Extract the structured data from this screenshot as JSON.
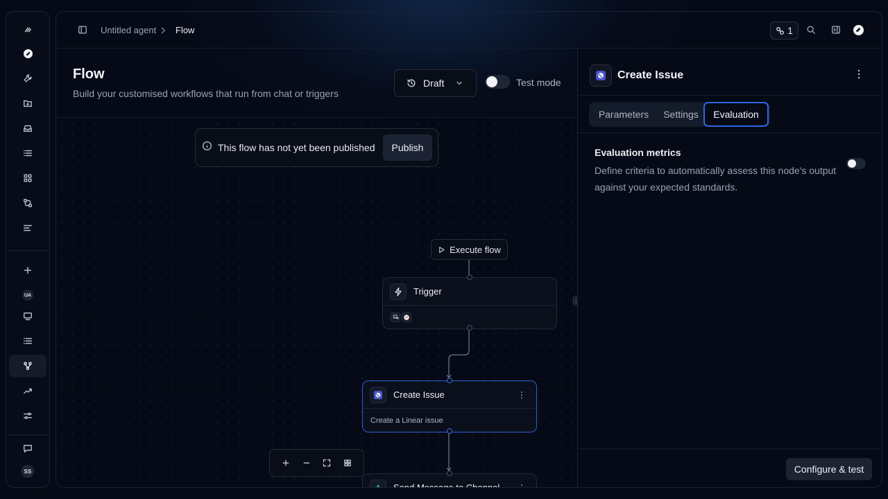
{
  "breadcrumb": {
    "agent": "Untitled agent",
    "current": "Flow"
  },
  "topbar": {
    "badge_count": "1"
  },
  "flow": {
    "title": "Flow",
    "subtitle": "Build your customised workflows that run from chat or triggers",
    "status_label": "Draft",
    "test_mode_label": "Test mode",
    "test_mode_on": false
  },
  "banner": {
    "message": "This flow has not yet been published",
    "publish_label": "Publish"
  },
  "canvas": {
    "execute_label": "Execute flow",
    "nodes": [
      {
        "title": "Trigger",
        "icon": "lightning-icon"
      },
      {
        "title": "Create Issue",
        "subtitle": "Create a Linear issue",
        "icon": "linear-icon"
      },
      {
        "title": "Send Message to Channel",
        "icon": "slack-icon"
      }
    ]
  },
  "panel": {
    "title": "Create Issue",
    "tabs": [
      "Parameters",
      "Settings",
      "Evaluation"
    ],
    "active_tab": "Evaluation",
    "eval_title": "Evaluation metrics",
    "eval_description": "Define criteria to automatically assess this node's output against your expected standards.",
    "eval_enabled": false,
    "config_label": "Configure & test"
  },
  "colors": {
    "background": "#050a16",
    "accent_blue": "#2f66e6",
    "panel_button": "#1c2333"
  }
}
